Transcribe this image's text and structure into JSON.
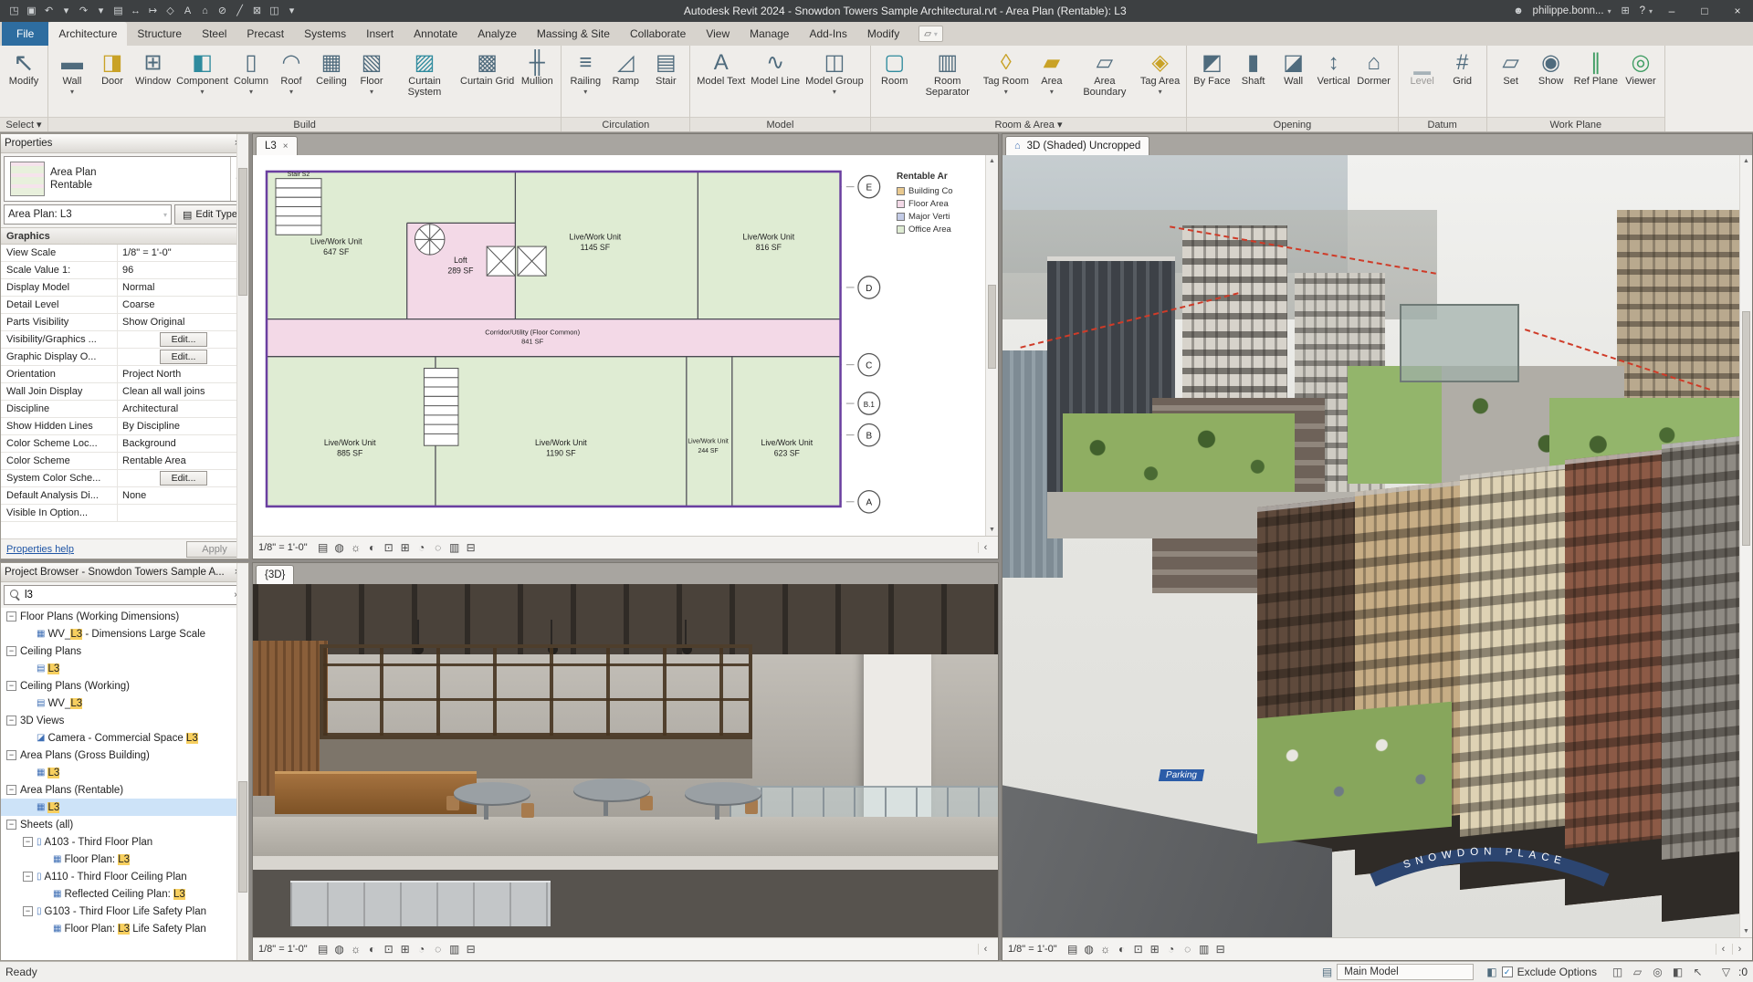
{
  "colors": {
    "file_tab": "#2e6da0",
    "office_area_green": "#dfecd3",
    "floor_area_pink": "#f3d9e7",
    "search_highlight": "#f7cf5f",
    "selection_blue": "#cde3f8"
  },
  "titlebar": {
    "qat": [
      {
        "name": "open-file-icon",
        "glyph": "◳"
      },
      {
        "name": "save-icon",
        "glyph": "▣"
      },
      {
        "name": "undo-icon",
        "glyph": "↶"
      },
      {
        "name": "undo-dropdown-icon",
        "glyph": "▾"
      },
      {
        "name": "redo-icon",
        "glyph": "↷"
      },
      {
        "name": "redo-dropdown-icon",
        "glyph": "▾"
      },
      {
        "name": "print-icon",
        "glyph": "▤"
      },
      {
        "name": "measure-icon",
        "glyph": "↔"
      },
      {
        "name": "aligned-dimension-icon",
        "glyph": "↦"
      },
      {
        "name": "tag-by-category-icon",
        "glyph": "◇"
      },
      {
        "name": "text-icon",
        "glyph": "A"
      },
      {
        "name": "default-3d-view-icon",
        "glyph": "⌂"
      },
      {
        "name": "section-icon",
        "glyph": "⊘"
      },
      {
        "name": "thin-lines-icon",
        "glyph": "╱"
      },
      {
        "name": "close-hidden-windows-icon",
        "glyph": "⊠"
      },
      {
        "name": "switch-windows-icon",
        "glyph": "◫"
      },
      {
        "name": "qat-customize-icon",
        "glyph": "▾"
      }
    ],
    "title": "Autodesk Revit 2024 - Snowdon Towers Sample Architectural.rvt - Area Plan (Rentable): L3",
    "user_icon": "☻",
    "user": "philippe.bonn...",
    "user_caret": "▾",
    "store_icon": "⊞",
    "help_label": "?",
    "help_caret": "▾",
    "win_min": "–",
    "win_max": "□",
    "win_close": "×"
  },
  "ribbon": {
    "tabs": [
      {
        "name": "tab-file",
        "label": "File",
        "cls": "file"
      },
      {
        "name": "tab-architecture",
        "label": "Architecture",
        "cls": "active"
      },
      {
        "name": "tab-structure",
        "label": "Structure",
        "cls": ""
      },
      {
        "name": "tab-steel",
        "label": "Steel",
        "cls": ""
      },
      {
        "name": "tab-precast",
        "label": "Precast",
        "cls": ""
      },
      {
        "name": "tab-systems",
        "label": "Systems",
        "cls": ""
      },
      {
        "name": "tab-insert",
        "label": "Insert",
        "cls": ""
      },
      {
        "name": "tab-annotate",
        "label": "Annotate",
        "cls": ""
      },
      {
        "name": "tab-analyze",
        "label": "Analyze",
        "cls": ""
      },
      {
        "name": "tab-massing-site",
        "label": "Massing & Site",
        "cls": ""
      },
      {
        "name": "tab-collaborate",
        "label": "Collaborate",
        "cls": ""
      },
      {
        "name": "tab-view",
        "label": "View",
        "cls": ""
      },
      {
        "name": "tab-manage",
        "label": "Manage",
        "cls": ""
      },
      {
        "name": "tab-addins",
        "label": "Add-Ins",
        "cls": ""
      },
      {
        "name": "tab-modify",
        "label": "Modify",
        "cls": ""
      }
    ],
    "state_toggle_glyph": "▱",
    "state_toggle_caret": "▾",
    "select_panel": {
      "caption": "Select ▾",
      "tools": [
        {
          "name": "modify-tool",
          "label": "Modify",
          "glyph": "↖",
          "arrow": "",
          "cls": "modify"
        }
      ]
    },
    "build_panel": {
      "caption": "Build",
      "tools": [
        {
          "name": "wall-tool",
          "label": "Wall",
          "glyph": "▬",
          "arrow": "▾",
          "cls": ""
        },
        {
          "name": "door-tool",
          "label": "Door",
          "glyph": "◨",
          "arrow": "",
          "cls": "gold"
        },
        {
          "name": "window-tool",
          "label": "Window",
          "glyph": "⊞",
          "arrow": "",
          "cls": ""
        },
        {
          "name": "component-tool",
          "label": "Component",
          "glyph": "◧",
          "arrow": "▾",
          "cls": "teal"
        },
        {
          "name": "column-tool",
          "label": "Column",
          "glyph": "▯",
          "arrow": "▾",
          "cls": ""
        },
        {
          "name": "roof-tool",
          "label": "Roof",
          "glyph": "◠",
          "arrow": "▾",
          "cls": ""
        },
        {
          "name": "ceiling-tool",
          "label": "Ceiling",
          "glyph": "▦",
          "arrow": "",
          "cls": ""
        },
        {
          "name": "floor-tool",
          "label": "Floor",
          "glyph": "▧",
          "arrow": "▾",
          "cls": ""
        },
        {
          "name": "curtain-system-tool",
          "label": "Curtain System",
          "glyph": "▨",
          "arrow": "",
          "cls": "teal"
        },
        {
          "name": "curtain-grid-tool",
          "label": "Curtain Grid",
          "glyph": "▩",
          "arrow": "",
          "cls": ""
        },
        {
          "name": "mullion-tool",
          "label": "Mullion",
          "glyph": "╫",
          "arrow": "",
          "cls": ""
        }
      ]
    },
    "circulation_panel": {
      "caption": "Circulation",
      "tools": [
        {
          "name": "railing-tool",
          "label": "Railing",
          "glyph": "≡",
          "arrow": "▾",
          "cls": ""
        },
        {
          "name": "ramp-tool",
          "label": "Ramp",
          "glyph": "◿",
          "arrow": "",
          "cls": ""
        },
        {
          "name": "stair-tool",
          "label": "Stair",
          "glyph": "▤",
          "arrow": "",
          "cls": ""
        }
      ]
    },
    "model_panel": {
      "caption": "Model",
      "tools": [
        {
          "name": "model-text-tool",
          "label": "Model Text",
          "glyph": "A",
          "arrow": "",
          "cls": ""
        },
        {
          "name": "model-line-tool",
          "label": "Model Line",
          "glyph": "∿",
          "arrow": "",
          "cls": ""
        },
        {
          "name": "model-group-tool",
          "label": "Model Group",
          "glyph": "◫",
          "arrow": "▾",
          "cls": ""
        }
      ]
    },
    "room_area_panel": {
      "caption": "Room & Area ▾",
      "tools": [
        {
          "name": "room-tool",
          "label": "Room",
          "glyph": "▢",
          "arrow": "",
          "cls": "teal"
        },
        {
          "name": "room-separator-tool",
          "label": "Room Separator",
          "glyph": "▥",
          "arrow": "",
          "cls": ""
        },
        {
          "name": "tag-room-tool",
          "label": "Tag Room",
          "glyph": "◊",
          "arrow": "▾",
          "cls": "gold"
        },
        {
          "name": "area-tool",
          "label": "Area",
          "glyph": "▰",
          "arrow": "▾",
          "cls": "gold"
        },
        {
          "name": "area-boundary-tool",
          "label": "Area Boundary",
          "glyph": "▱",
          "arrow": "",
          "cls": ""
        },
        {
          "name": "tag-area-tool",
          "label": "Tag Area",
          "glyph": "◈",
          "arrow": "▾",
          "cls": "gold"
        }
      ]
    },
    "opening_panel": {
      "caption": "Opening",
      "tools": [
        {
          "name": "by-face-tool",
          "label": "By Face",
          "glyph": "◩",
          "arrow": "",
          "cls": ""
        },
        {
          "name": "shaft-tool",
          "label": "Shaft",
          "glyph": "▮",
          "arrow": "",
          "cls": ""
        },
        {
          "name": "wall-opening-tool",
          "label": "Wall",
          "glyph": "◪",
          "arrow": "",
          "cls": ""
        },
        {
          "name": "vertical-opening-tool",
          "label": "Vertical",
          "glyph": "↕",
          "arrow": "",
          "cls": ""
        },
        {
          "name": "dormer-tool",
          "label": "Dormer",
          "glyph": "⌂",
          "arrow": "",
          "cls": ""
        }
      ]
    },
    "datum_panel": {
      "caption": "Datum",
      "tools": [
        {
          "name": "level-tool",
          "label": "Level",
          "glyph": "▁",
          "arrow": "",
          "cls": "disabled"
        },
        {
          "name": "grid-tool",
          "label": "Grid",
          "glyph": "#",
          "arrow": "",
          "cls": ""
        }
      ]
    },
    "work_plane_panel": {
      "caption": "Work Plane",
      "tools": [
        {
          "name": "set-work-plane-tool",
          "label": "Set",
          "glyph": "▱",
          "arrow": "",
          "cls": ""
        },
        {
          "name": "show-work-plane-tool",
          "label": "Show",
          "glyph": "◉",
          "arrow": "",
          "cls": ""
        },
        {
          "name": "ref-plane-tool",
          "label": "Ref Plane",
          "glyph": "∥",
          "arrow": "",
          "cls": "green"
        },
        {
          "name": "viewer-tool",
          "label": "Viewer",
          "glyph": "◎",
          "arrow": "",
          "cls": "green"
        }
      ]
    }
  },
  "properties": {
    "header": "Properties",
    "close_glyph": "×",
    "type_name_line1": "Area Plan",
    "type_name_line2": "Rentable",
    "type_caret": "▾",
    "selector_value": "Area Plan: L3",
    "selector_caret": "▾",
    "edit_type_icon": "▤",
    "edit_type_label": "Edit Type",
    "section_label": "Graphics",
    "collapse_glyph": "∧",
    "rows": [
      {
        "label": "View Scale",
        "value": "1/8\" = 1'-0\"",
        "cls": ""
      },
      {
        "label": "Scale Value   1:",
        "value": "96",
        "cls": ""
      },
      {
        "label": "Display Model",
        "value": "Normal",
        "cls": ""
      },
      {
        "label": "Detail Level",
        "value": "Coarse",
        "cls": ""
      },
      {
        "label": "Parts Visibility",
        "value": "Show Original",
        "cls": ""
      },
      {
        "label": "Visibility/Graphics ...",
        "value": "Edit...",
        "cls": "btn"
      },
      {
        "label": "Graphic Display O...",
        "value": "Edit...",
        "cls": "btn"
      },
      {
        "label": "Orientation",
        "value": "Project North",
        "cls": ""
      },
      {
        "label": "Wall Join Display",
        "value": "Clean all wall joins",
        "cls": ""
      },
      {
        "label": "Discipline",
        "value": "Architectural",
        "cls": ""
      },
      {
        "label": "Show Hidden Lines",
        "value": "By Discipline",
        "cls": ""
      },
      {
        "label": "Color Scheme Loc...",
        "value": "Background",
        "cls": ""
      },
      {
        "label": "Color Scheme",
        "value": "Rentable Area",
        "cls": ""
      },
      {
        "label": "System Color Sche...",
        "value": "Edit...",
        "cls": "btn"
      },
      {
        "label": "Default Analysis Di...",
        "value": "None",
        "cls": ""
      },
      {
        "label": "Visible In Option...",
        "value": "",
        "cls": ""
      }
    ],
    "help_link": "Properties help",
    "apply_label": "Apply"
  },
  "project_browser": {
    "header": "Project Browser - Snowdon Towers Sample A...",
    "close_glyph": "×",
    "search_value": "l3",
    "clear_glyph": "×",
    "tree": [
      {
        "cls": "d0",
        "expander": "−",
        "icon": "",
        "prefix": "Floor Plans (Working Dimensions)",
        "match": "",
        "suffix": ""
      },
      {
        "cls": "d1",
        "expander": "",
        "icon": "▦",
        "prefix": "WV_",
        "match": "L3",
        "suffix": " - Dimensions Large Scale"
      },
      {
        "cls": "d0",
        "expander": "−",
        "icon": "",
        "prefix": "Ceiling Plans",
        "match": "",
        "suffix": ""
      },
      {
        "cls": "d1",
        "expander": "",
        "icon": "▤",
        "prefix": "",
        "match": "L3",
        "suffix": ""
      },
      {
        "cls": "d0",
        "expander": "−",
        "icon": "",
        "prefix": "Ceiling Plans (Working)",
        "match": "",
        "suffix": ""
      },
      {
        "cls": "d1",
        "expander": "",
        "icon": "▤",
        "prefix": "WV_",
        "match": "L3",
        "suffix": ""
      },
      {
        "cls": "d0",
        "expander": "−",
        "icon": "",
        "prefix": "3D Views",
        "match": "",
        "suffix": ""
      },
      {
        "cls": "d1",
        "expander": "",
        "icon": "◪",
        "prefix": "Camera - Commercial Space ",
        "match": "L3",
        "suffix": ""
      },
      {
        "cls": "d0",
        "expander": "−",
        "icon": "",
        "prefix": "Area Plans (Gross Building)",
        "match": "",
        "suffix": ""
      },
      {
        "cls": "d1",
        "expander": "",
        "icon": "▦",
        "prefix": "",
        "match": "L3",
        "suffix": ""
      },
      {
        "cls": "d0",
        "expander": "−",
        "icon": "",
        "prefix": "Area Plans (Rentable)",
        "match": "",
        "suffix": ""
      },
      {
        "cls": "d1 selected",
        "expander": "",
        "icon": "▦",
        "prefix": "",
        "match": "L3",
        "suffix": ""
      },
      {
        "cls": "d0",
        "expander": "−",
        "icon": "",
        "prefix": "Sheets (all)",
        "match": "",
        "suffix": ""
      },
      {
        "cls": "d1",
        "expander": "−",
        "icon": "▯",
        "prefix": "A103 - Third Floor Plan",
        "match": "",
        "suffix": ""
      },
      {
        "cls": "d2",
        "expander": "",
        "icon": "▦",
        "prefix": "Floor Plan: ",
        "match": "L3",
        "suffix": ""
      },
      {
        "cls": "d1",
        "expander": "−",
        "icon": "▯",
        "prefix": "A110 - Third Floor Ceiling Plan",
        "match": "",
        "suffix": ""
      },
      {
        "cls": "d2",
        "expander": "",
        "icon": "▦",
        "prefix": "Reflected Ceiling Plan: ",
        "match": "L3",
        "suffix": ""
      },
      {
        "cls": "d1",
        "expander": "−",
        "icon": "▯",
        "prefix": "G103 - Third Floor Life Safety Plan",
        "match": "",
        "suffix": ""
      },
      {
        "cls": "d2",
        "expander": "",
        "icon": "▦",
        "prefix": "Floor Plan: ",
        "match": "L3",
        "suffix": " Life Safety Plan"
      }
    ]
  },
  "viewports": {
    "plan": {
      "tab": "L3",
      "close": "×",
      "scale": "1/8\" = 1'-0\""
    },
    "interior": {
      "tab": "{3D}",
      "scale": "1/8\" = 1'-0\""
    },
    "city": {
      "tab": "3D (Shaded) Uncropped",
      "home_icon": "⌂",
      "scale": "1/8\" = 1'-0\""
    }
  },
  "view_control_icons": [
    {
      "name": "detail-level-icon",
      "glyph": "▤"
    },
    {
      "name": "visual-style-icon",
      "glyph": "◍"
    },
    {
      "name": "sun-path-icon",
      "glyph": "☼"
    },
    {
      "name": "shadows-icon",
      "glyph": "◐"
    },
    {
      "name": "crop-view-icon",
      "glyph": "⊡"
    },
    {
      "name": "show-crop-icon",
      "glyph": "⊞"
    },
    {
      "name": "temporary-hide-isolate-icon",
      "glyph": "◔"
    },
    {
      "name": "reveal-hidden-elements-icon",
      "glyph": "◌"
    },
    {
      "name": "temporary-view-properties-icon",
      "glyph": "▥"
    },
    {
      "name": "show-constraints-icon",
      "glyph": "⊟"
    }
  ],
  "plan": {
    "stair_label": "Stair S2",
    "grids": [
      "E",
      "D",
      "C",
      "B.1",
      "B",
      "A"
    ],
    "rooms": [
      {
        "name": "Live/Work Unit",
        "area": "647 SF"
      },
      {
        "name": "Live/Work Unit",
        "area": "1145 SF"
      },
      {
        "name": "Live/Work Unit",
        "area": "816 SF"
      },
      {
        "name": "Loft",
        "area": "289 SF"
      },
      {
        "name": "Corridor/Utility (Floor Common)",
        "area": "841 SF"
      },
      {
        "name": "Live/Work Unit",
        "area": "885 SF"
      },
      {
        "name": "Live/Work Unit",
        "area": "1190 SF"
      },
      {
        "name": "Live/Work Unit",
        "area": "244 SF"
      },
      {
        "name": "Live/Work Unit",
        "area": "623 SF"
      }
    ],
    "legend": {
      "title": "Rentable Ar",
      "items": [
        {
          "label": "Building Co",
          "color": "#e9c98f"
        },
        {
          "label": "Floor Area",
          "color": "#f3d9e7"
        },
        {
          "label": "Major Verti",
          "color": "#c3cbe6"
        },
        {
          "label": "Office Area",
          "color": "#dfecd3"
        }
      ]
    }
  },
  "city": {
    "arch_text": "SNOWDON PLACE",
    "parking_text": "Parking"
  },
  "statusbar": {
    "ready": "Ready",
    "worksets_icon": "▤",
    "workset_value": "Main Model",
    "design_options_icon": "◧",
    "exclude_check": "✓",
    "exclude_label": "Exclude Options",
    "toggles": [
      {
        "name": "select-links-icon",
        "glyph": "◫"
      },
      {
        "name": "select-underlay-icon",
        "glyph": "▱"
      },
      {
        "name": "select-pinned-icon",
        "glyph": "◎"
      },
      {
        "name": "select-by-face-icon",
        "glyph": "◧"
      },
      {
        "name": "drag-on-selection-icon",
        "glyph": "↖"
      }
    ],
    "filter_icon": "▽",
    "filter_count": ":0"
  }
}
